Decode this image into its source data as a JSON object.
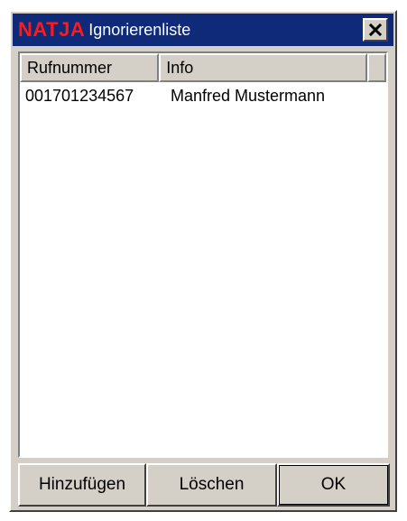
{
  "window": {
    "brand": "NATJA",
    "title": "Ignorierenliste",
    "close_icon": "close-icon"
  },
  "list": {
    "columns": [
      "Rufnummer",
      "Info"
    ],
    "rows": [
      {
        "number": "001701234567",
        "info": "Manfred Mustermann"
      }
    ]
  },
  "buttons": {
    "add_label": "Hinzufügen",
    "delete_label": "Löschen",
    "ok_label": "OK"
  },
  "colors": {
    "titlebar": "#0f2a78",
    "brand": "#ff1a1a",
    "face": "#d4d0c8"
  }
}
